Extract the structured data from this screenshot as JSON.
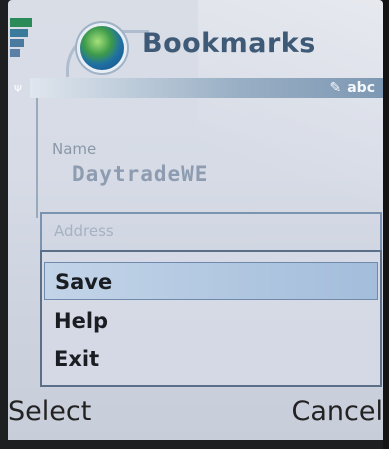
{
  "header": {
    "title": "Bookmarks",
    "input_mode": "abc",
    "icons": [
      "signal-bars",
      "globe-icon",
      "pen-icon",
      "antenna-icon"
    ]
  },
  "form": {
    "name_label": "Name",
    "name_value": "DaytradeWE",
    "address_label": "Address"
  },
  "menu": {
    "items": [
      {
        "label": "Save",
        "selected": true
      },
      {
        "label": "Help",
        "selected": false
      },
      {
        "label": "Exit",
        "selected": false
      }
    ]
  },
  "softkeys": {
    "left": "Select",
    "right": "Cancel"
  },
  "colors": {
    "screen_bg": "#d6dbe6",
    "title": "#3f5a76",
    "highlight": "#a3bddb"
  }
}
